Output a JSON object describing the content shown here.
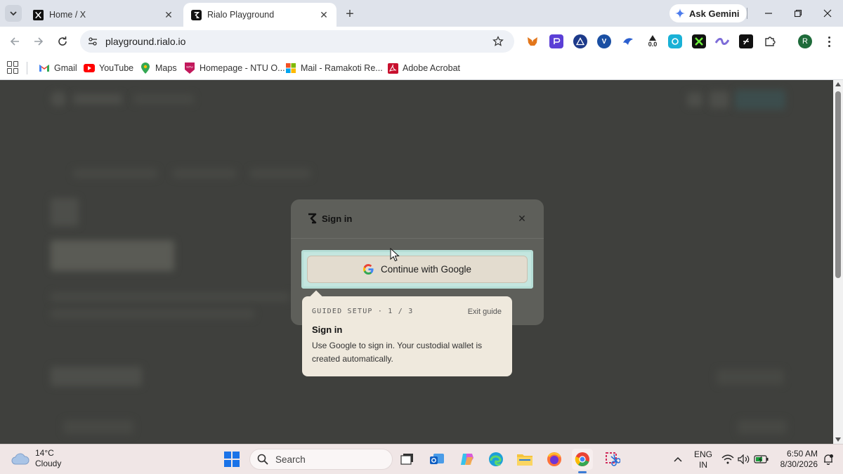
{
  "browser": {
    "tabs": [
      {
        "title": "Home / X",
        "favicon": "x-logo-icon",
        "active": false
      },
      {
        "title": "Rialo Playground",
        "favicon": "rialo-logo-icon",
        "active": true
      }
    ],
    "ask_gemini_label": "Ask Gemini",
    "url": "playground.rialo.io",
    "profile_initial": "R",
    "extension_badge": "0.0",
    "bookmarks": [
      {
        "label": "Gmail",
        "icon": "gmail-icon"
      },
      {
        "label": "YouTube",
        "icon": "youtube-icon"
      },
      {
        "label": "Maps",
        "icon": "maps-icon"
      },
      {
        "label": "Homepage - NTU O...",
        "icon": "ntu-icon"
      },
      {
        "label": "Mail - Ramakoti Re...",
        "icon": "microsoft-icon"
      },
      {
        "label": "Adobe Acrobat",
        "icon": "acrobat-icon"
      }
    ]
  },
  "modal": {
    "title": "Sign in",
    "google_button_label": "Continue with Google"
  },
  "guide": {
    "step": "GUIDED SETUP · 1 / 3",
    "exit_label": "Exit guide",
    "title": "Sign in",
    "body": "Use Google to sign in. Your custodial wallet is created automatically."
  },
  "taskbar": {
    "weather_temp": "14°C",
    "weather_desc": "Cloudy",
    "search_placeholder": "Search",
    "lang_line1": "ENG",
    "lang_line2": "IN",
    "time": "6:50 AM",
    "date": "8/30/2026"
  },
  "colors": {
    "overlay": "#3f403d",
    "modal_bg": "#5e5f5a",
    "google_button_bg": "#e3dccf",
    "focus_ring": "#b6ded6",
    "guide_bg": "#efe9dd",
    "taskbar_bg": "#f0e6e6"
  }
}
